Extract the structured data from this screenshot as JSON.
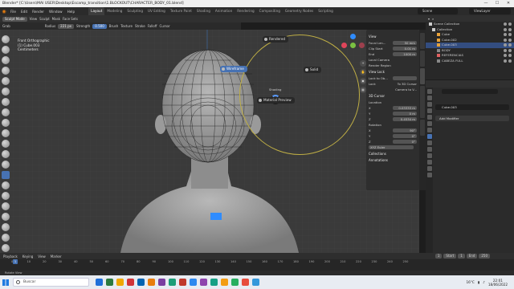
{
  "window": {
    "title": "Blender* [C:\\Users\\MAI USER\\Desktop\\Escamp_transition\\1.BLOCKOUT\\CHARACTER_BODY_01.blend]",
    "controls": [
      "—",
      "☐",
      "✕"
    ]
  },
  "menu": {
    "items": [
      "File",
      "Edit",
      "Render",
      "Window",
      "Help"
    ],
    "tabs": [
      "Layout",
      "Modeling",
      "Sculpting",
      "UV Editing",
      "Texture Paint",
      "Shading",
      "Animation",
      "Rendering",
      "Compositing",
      "Geometry Nodes",
      "Scripting"
    ],
    "active_tab": "Layout",
    "scene": "Scene",
    "view_layer": "ViewLayer"
  },
  "tool_header": {
    "mode": "Sculpt Mode",
    "items": [
      "View",
      "Sculpt",
      "Mask",
      "Face Sets"
    ],
    "brush": "Grab",
    "radius_label": "Radius",
    "radius_value": "221 px",
    "strength_label": "Strength",
    "strength_value": "0.500",
    "extra": [
      "Brush",
      "Texture",
      "Stroke",
      "Falloff",
      "Cursor"
    ]
  },
  "viewport": {
    "info": [
      "Front Orthographic",
      "(1) Cube.003",
      "Centimeters"
    ]
  },
  "pie_menu": {
    "top": "Rendered",
    "left": "Wireframe",
    "right": "Solid",
    "bottom": "Material Preview",
    "center_label": "Shading"
  },
  "npanel": {
    "view_header": "View",
    "focal_label": "Focal Len...",
    "focal_value": "50 mm",
    "clip_start_label": "Clip Start",
    "clip_start_value": "0.01 m",
    "clip_end_label": "End",
    "clip_end_value": "1000 m",
    "local_camera": "Local Camera",
    "render_region": "Render Region",
    "view_lock": "View Lock",
    "lock_to_object": "Lock to Ob...",
    "lock": "Lock",
    "lock_3d_cursor": "To 3D Cursor",
    "camera_to_view": "Camera to V...",
    "cursor_header": "3D Cursor",
    "location": "Location",
    "loc_x": "0.03333 m",
    "loc_y": "0 m",
    "loc_z": "0.4534 m",
    "rotation": "Rotation",
    "rot_x": "90°",
    "rot_y": "0°",
    "rot_z": "0°",
    "rot_mode": "XYZ Euler",
    "collections": "Collections",
    "annotations": "Annotations",
    "tabs": [
      "Item",
      "Tool",
      "View",
      "Screencast Keys",
      "Edit"
    ]
  },
  "outliner": {
    "header": "Scene Collection",
    "rows": [
      {
        "label": "Scene Collection",
        "selected": false,
        "color": "#cccccc"
      },
      {
        "label": "Collection",
        "selected": false,
        "color": "#cccccc"
      },
      {
        "label": "Cube",
        "selected": false,
        "color": "#e8a23a"
      },
      {
        "label": "Cube.002",
        "selected": false,
        "color": "#e8a23a"
      },
      {
        "label": "Cube.003",
        "selected": true,
        "color": "#e8a23a"
      },
      {
        "label": "BODY",
        "selected": false,
        "color": "#888888"
      },
      {
        "label": "REFERENCIAS",
        "selected": false,
        "color": "#e06060"
      },
      {
        "label": "CABEZA FULL",
        "selected": false,
        "color": "#888888"
      }
    ]
  },
  "properties": {
    "search_placeholder": "",
    "object_name": "Cube.003",
    "add_modifier": "Add Modifier"
  },
  "timeline": {
    "menu": [
      "Playback",
      "Keying",
      "View",
      "Marker"
    ],
    "current_frame": "1",
    "start_label": "Start",
    "start": "1",
    "end_label": "End",
    "end": "250",
    "ticks": [
      "0",
      "10",
      "20",
      "30",
      "40",
      "50",
      "60",
      "70",
      "80",
      "90",
      "100",
      "110",
      "120",
      "130",
      "140",
      "150",
      "160",
      "170",
      "180",
      "190",
      "200",
      "210",
      "220",
      "230",
      "240",
      "250"
    ]
  },
  "statusbar": {
    "text": "Rotate View"
  },
  "taskbar": {
    "search_placeholder": "Buscar",
    "weather": "16°C",
    "time": "22:01",
    "date": "18/06/2022",
    "app_colors": [
      "#1e6fd9",
      "#2c7a3f",
      "#f0a800",
      "#d13438",
      "#0063b1",
      "#e87d0d",
      "#7a3ea0",
      "#1b9e77",
      "#c0392b",
      "#2d89ef",
      "#8e44ad",
      "#16a085",
      "#f39c12",
      "#27ae60",
      "#e74c3c",
      "#3498db"
    ]
  }
}
